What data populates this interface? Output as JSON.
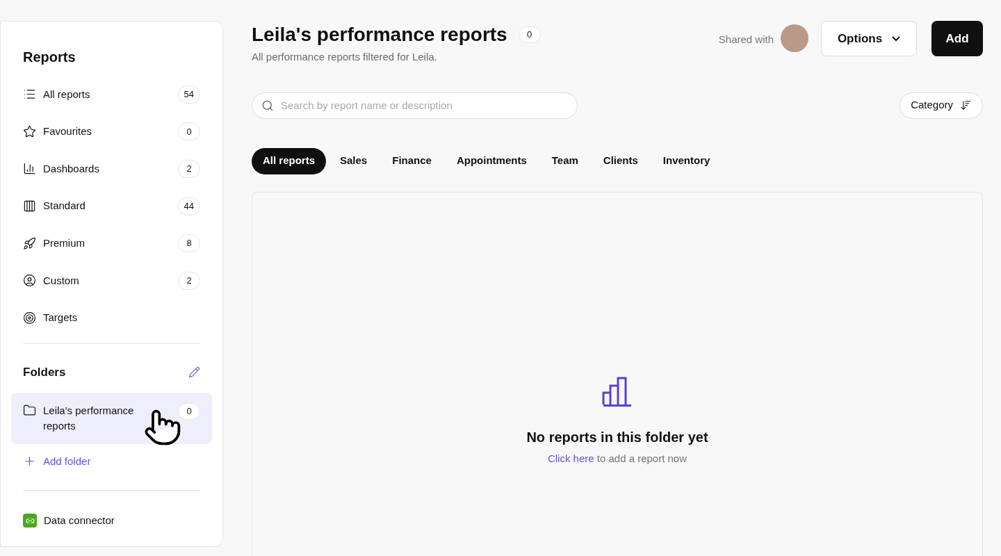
{
  "sidebar": {
    "title": "Reports",
    "items": [
      {
        "kind": "list",
        "label": "All reports",
        "count": "54"
      },
      {
        "kind": "star",
        "label": "Favourites",
        "count": "0"
      },
      {
        "kind": "chart",
        "label": "Dashboards",
        "count": "2"
      },
      {
        "kind": "columns",
        "label": "Standard",
        "count": "44"
      },
      {
        "kind": "rocket",
        "label": "Premium",
        "count": "8"
      },
      {
        "kind": "user",
        "label": "Custom",
        "count": "2"
      },
      {
        "kind": "target",
        "label": "Targets"
      }
    ],
    "folders_title": "Folders",
    "folders": [
      {
        "label": "Leila's performance reports",
        "count": "0",
        "selected": true
      }
    ],
    "add_folder": "Add folder",
    "data_connector": "Data connector"
  },
  "header": {
    "title": "Leila's performance reports",
    "count": "0",
    "subtitle": "All performance reports filtered for Leila.",
    "shared_with": "Shared with",
    "options": "Options",
    "add": "Add"
  },
  "search": {
    "placeholder": "Search by report name or description"
  },
  "category": "Category",
  "tabs": [
    {
      "label": "All reports",
      "selected": true
    },
    {
      "label": "Sales",
      "selected": false
    },
    {
      "label": "Finance",
      "selected": false
    },
    {
      "label": "Appointments",
      "selected": false
    },
    {
      "label": "Team",
      "selected": false
    },
    {
      "label": "Clients",
      "selected": false
    },
    {
      "label": "Inventory",
      "selected": false
    }
  ],
  "empty": {
    "title": "No reports in this folder yet",
    "link": "Click here",
    "text": "to add a report now"
  }
}
